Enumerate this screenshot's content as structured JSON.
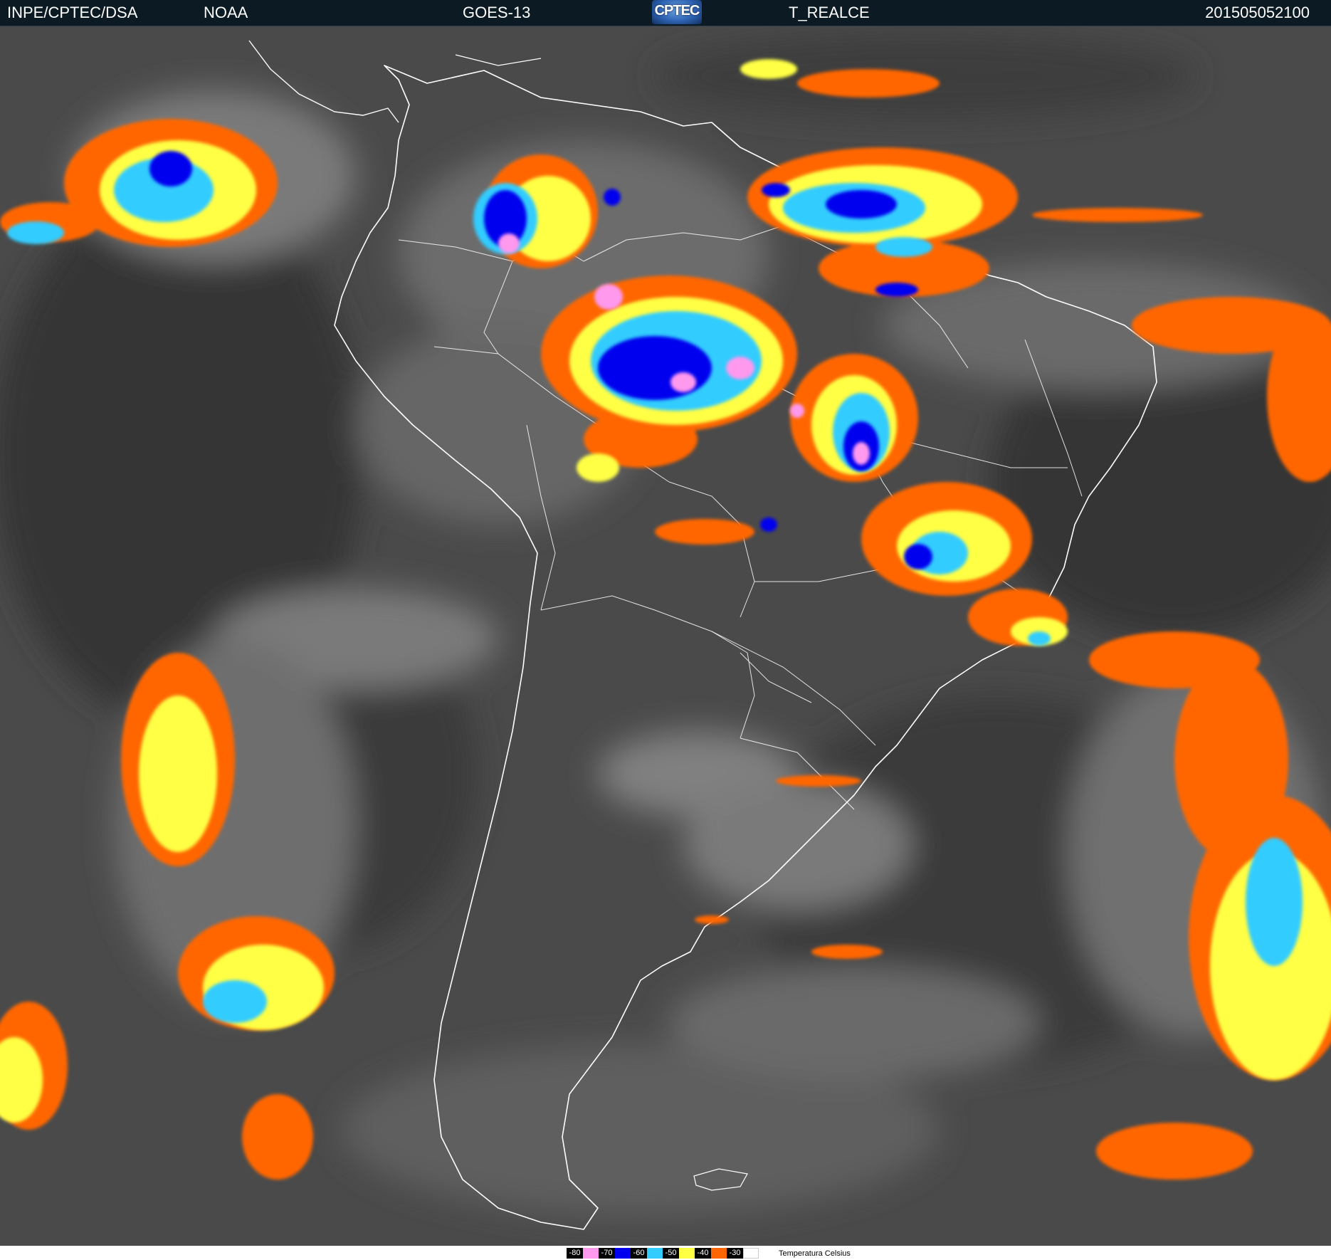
{
  "header": {
    "organization": "INPE/CPTEC/DSA",
    "agency": "NOAA",
    "satellite": "GOES-13",
    "logo_text": "CPTEC",
    "product": "T_REALCE",
    "timestamp": "201505052100"
  },
  "legend": {
    "caption": "Temperatura  Celsius",
    "items": [
      {
        "label": "-80",
        "color": "#ff99ee"
      },
      {
        "label": "-70",
        "color": "#0000ee"
      },
      {
        "label": "-60",
        "color": "#33ccff"
      },
      {
        "label": "-50",
        "color": "#ffff44"
      },
      {
        "label": "-40",
        "color": "#ff6600"
      },
      {
        "label": "-30",
        "color": "#ffffff"
      }
    ]
  },
  "palette": {
    "background_cloud": "#5a5a5a",
    "ocean_dark": "#3a3a3a",
    "coastline": "#ffffff",
    "cold_pink": "#ff99ee",
    "cold_blue": "#0000ee",
    "cold_cyan": "#33ccff",
    "cold_yellow": "#ffff44",
    "cold_orange": "#ff6600"
  }
}
